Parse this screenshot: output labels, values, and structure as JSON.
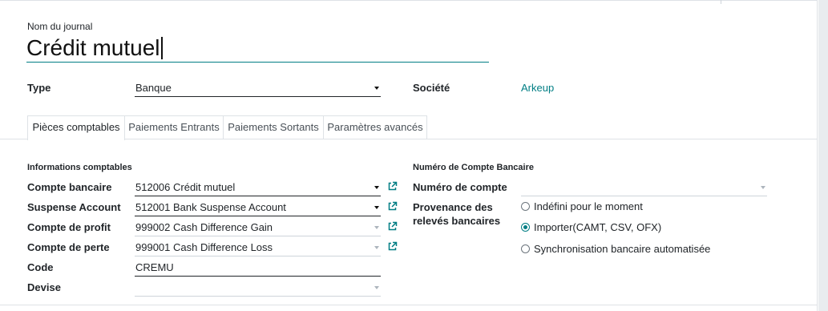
{
  "form": {
    "journal_name_label": "Nom du journal",
    "journal_name": "Crédit mutuel",
    "type_label": "Type",
    "type_value": "Banque",
    "company_label": "Société",
    "company_value": "Arkeup"
  },
  "tabs": [
    {
      "label": "Pièces comptables",
      "active": true
    },
    {
      "label": "Paiements Entrants",
      "active": false
    },
    {
      "label": "Paiements Sortants",
      "active": false
    },
    {
      "label": "Paramètres avancés",
      "active": false
    }
  ],
  "accounting": {
    "section_title": "Informations comptables",
    "bank_account_label": "Compte bancaire",
    "bank_account_value": "512006 Crédit mutuel",
    "suspense_label": "Suspense Account",
    "suspense_value": "512001 Bank Suspense Account",
    "profit_label": "Compte de profit",
    "profit_value": "999002 Cash Difference Gain",
    "loss_label": "Compte de perte",
    "loss_value": "999001 Cash Difference Loss",
    "code_label": "Code",
    "code_value": "CREMU",
    "currency_label": "Devise",
    "currency_value": ""
  },
  "bank": {
    "section_title": "Numéro de Compte Bancaire",
    "account_number_label": "Numéro de compte",
    "account_number_value": "",
    "source_label_line1": "Provenance des",
    "source_label_line2": "relevés bancaires",
    "options": [
      {
        "label": "Indéfini pour le moment",
        "selected": false
      },
      {
        "label": "Importer(CAMT, CSV, OFX)",
        "selected": true
      },
      {
        "label": "Synchronisation bancaire automatisée",
        "selected": false
      }
    ]
  },
  "colors": {
    "accent": "#017e84",
    "text": "#212529",
    "muted": "#adb5bd"
  }
}
